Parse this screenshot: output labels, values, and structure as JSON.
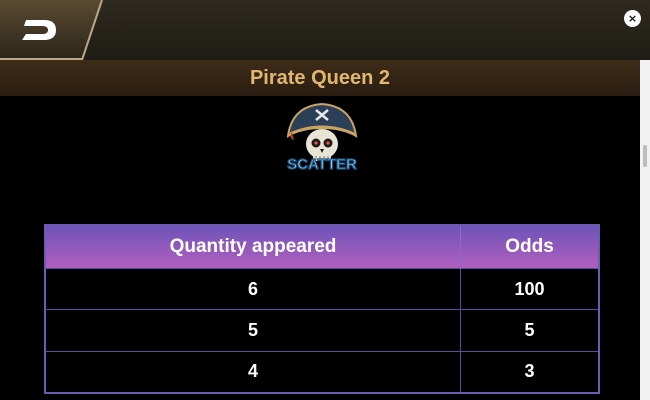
{
  "header": {
    "title": "Pirate Queen 2",
    "close_label": "×",
    "logo_icon": "d-logo-icon"
  },
  "symbol": {
    "label": "SCATTER",
    "icon": "pirate-skull-scatter-icon"
  },
  "paytable": {
    "columns": [
      "Quantity appeared",
      "Odds"
    ],
    "rows": [
      [
        "6",
        "100"
      ],
      [
        "5",
        "5"
      ],
      [
        "4",
        "3"
      ]
    ]
  },
  "colors": {
    "title_text": "#e0b673",
    "header_gradient_top": "#6f53b8",
    "header_gradient_bottom": "#b15fbf",
    "table_border": "#6b5bb3"
  }
}
